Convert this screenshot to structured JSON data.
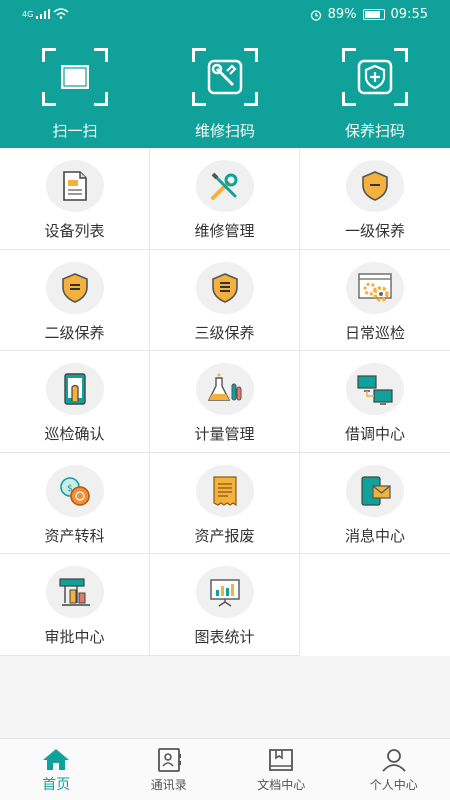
{
  "status": {
    "network": "4G",
    "battery": "89%",
    "time": "09:55",
    "battery_level": 0.89
  },
  "scan": [
    {
      "label": "扫一扫",
      "icon": "scan-icon"
    },
    {
      "label": "维修扫码",
      "icon": "repair-scan-icon"
    },
    {
      "label": "保养扫码",
      "icon": "maintain-scan-icon"
    }
  ],
  "grid": [
    {
      "label": "设备列表",
      "icon": "document-icon"
    },
    {
      "label": "维修管理",
      "icon": "tools-icon"
    },
    {
      "label": "一级保养",
      "icon": "shield-level1-icon"
    },
    {
      "label": "二级保养",
      "icon": "shield-level2-icon"
    },
    {
      "label": "三级保养",
      "icon": "shield-level3-icon"
    },
    {
      "label": "日常巡检",
      "icon": "gears-icon"
    },
    {
      "label": "巡检确认",
      "icon": "tablet-confirm-icon"
    },
    {
      "label": "计量管理",
      "icon": "flask-icon"
    },
    {
      "label": "借调中心",
      "icon": "computers-icon"
    },
    {
      "label": "资产转科",
      "icon": "coins-icon"
    },
    {
      "label": "资产报废",
      "icon": "receipt-icon"
    },
    {
      "label": "消息中心",
      "icon": "message-icon"
    },
    {
      "label": "审批中心",
      "icon": "approval-icon"
    },
    {
      "label": "图表统计",
      "icon": "chart-board-icon"
    }
  ],
  "tabs": [
    {
      "label": "首页",
      "icon": "home-icon"
    },
    {
      "label": "通讯录",
      "icon": "contacts-icon"
    },
    {
      "label": "文档中心",
      "icon": "book-icon"
    },
    {
      "label": "个人中心",
      "icon": "person-icon"
    }
  ],
  "colors": {
    "brand": "#10a29a",
    "accent": "#f5b13d"
  }
}
